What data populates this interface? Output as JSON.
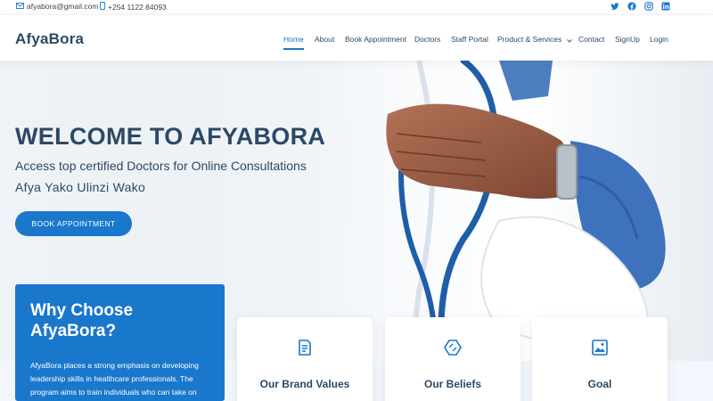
{
  "topbar": {
    "email": "afyabora@gmail.com",
    "phone": "+254 1122 84093",
    "social_icons": [
      "twitter-icon",
      "facebook-icon",
      "instagram-icon",
      "linkedin-icon"
    ]
  },
  "header": {
    "logo": "AfyaBora",
    "nav": [
      {
        "label": "Home",
        "active": true
      },
      {
        "label": "About"
      },
      {
        "label": "Book Appointment"
      },
      {
        "label": "Doctors"
      },
      {
        "label": "Staff Portal"
      },
      {
        "label": "Product & Services"
      },
      {
        "label": "Contact"
      },
      {
        "label": "SignUp"
      },
      {
        "label": "Login"
      }
    ]
  },
  "hero": {
    "title": "WELCOME TO AFYABORA",
    "subtitle1": "Access top certified Doctors for Online Consultations",
    "subtitle2": "Afya Yako Ulinzi Wako",
    "button": "BOOK APPOINTMENT"
  },
  "why": {
    "title": "Why Choose AfyaBora?",
    "text": "AfyaBora places a strong emphasis on developing leadership skills in healthcare professionals. The program aims to train individuals who can take on"
  },
  "cards": [
    {
      "title": "Our Brand Values",
      "icon": "document-icon"
    },
    {
      "title": "Our Beliefs",
      "icon": "hexagon-icon"
    },
    {
      "title": "Goal",
      "icon": "image-icon"
    }
  ],
  "colors": {
    "primary": "#1977cc",
    "heading": "#2c4964"
  }
}
